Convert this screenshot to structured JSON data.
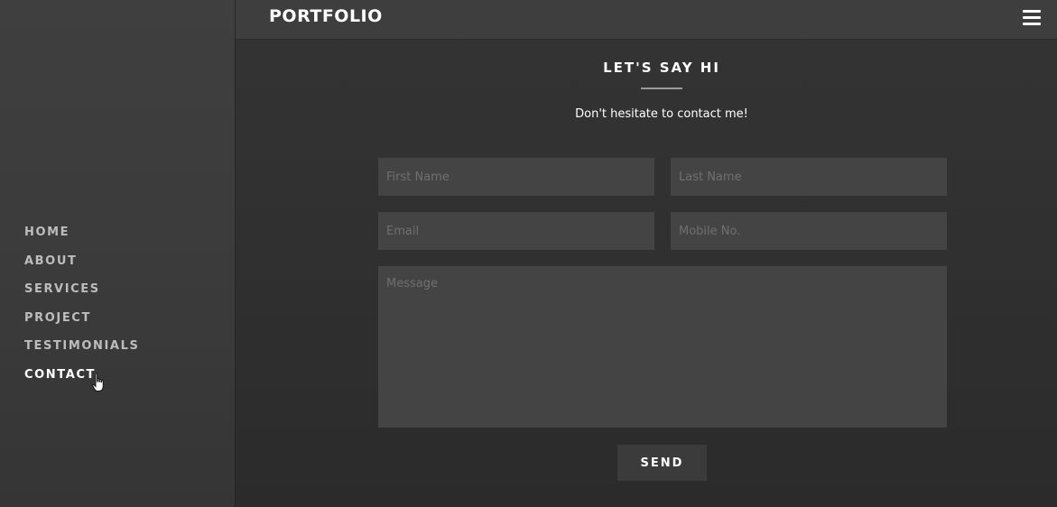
{
  "header": {
    "brand": "PORTFOLIO",
    "menu_icon": "hamburger-icon"
  },
  "sidebar": {
    "items": [
      {
        "label": "HOME",
        "active": false
      },
      {
        "label": "ABOUT",
        "active": false
      },
      {
        "label": "SERVICES",
        "active": false
      },
      {
        "label": "PROJECT",
        "active": false
      },
      {
        "label": "TESTIMONIALS",
        "active": false
      },
      {
        "label": "CONTACT",
        "active": true
      }
    ]
  },
  "contact": {
    "title": "LET'S SAY HI",
    "subtitle": "Don't hesitate to contact me!",
    "fields": {
      "first_name": {
        "placeholder": "First Name",
        "value": ""
      },
      "last_name": {
        "placeholder": "Last Name",
        "value": ""
      },
      "email": {
        "placeholder": "Email",
        "value": ""
      },
      "mobile": {
        "placeholder": "Mobile No.",
        "value": ""
      },
      "message": {
        "placeholder": "Message",
        "value": ""
      }
    },
    "send_label": "SEND"
  },
  "colors": {
    "background": "#2f2f2f",
    "sidebar": "#3d3d3d",
    "header": "#3e3e3e",
    "field": "#444444",
    "button": "#3b3b3b",
    "text": "#ffffff",
    "nav_text": "#bdbdbd"
  }
}
